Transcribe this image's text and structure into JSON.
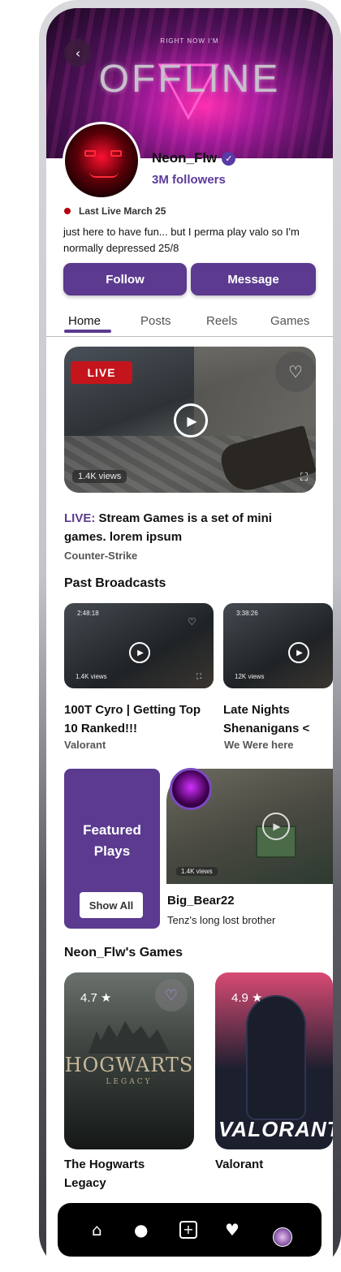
{
  "header": {
    "right_now": "RIGHT NOW I'M",
    "status": "OFFLINE",
    "back_icon": "chevron-left-icon"
  },
  "profile": {
    "name": "Neon_Flw",
    "followers": "3M followers",
    "last_live": "Last Live March 25",
    "bio": "just here to have fun... but I perma play valo so I'm normally depressed 25/8"
  },
  "actions": {
    "follow": "Follow",
    "message": "Message"
  },
  "tabs": [
    "Home",
    "Posts",
    "Reels",
    "Games"
  ],
  "live": {
    "badge": "LIVE",
    "views": "1.4K views",
    "title_prefix": "LIVE:",
    "title": " Stream Games is a set of mini games. lorem ipsum",
    "game": "Counter-Strike"
  },
  "past_broadcasts": {
    "heading": "Past Broadcasts",
    "items": [
      {
        "duration": "2:48:18",
        "views": "1.4K views",
        "title": "100T Cyro | Getting Top 10 Ranked!!!",
        "game": "Valorant"
      },
      {
        "duration": "3:38:26",
        "views": "12K views",
        "title": "Late Nights Shenanigans <",
        "game": "We Were here"
      }
    ]
  },
  "featured": {
    "label": "Featured Plays",
    "show_all": "Show All",
    "views": "1.4K views",
    "user": "Big_Bear22",
    "caption": "Tenz's long lost brother"
  },
  "games": {
    "heading": "Neon_Flw's Games",
    "items": [
      {
        "rating": "4.7 ★",
        "logo": "HOGWARTS",
        "logo_sub": "LEGACY",
        "title": "The Hogwarts Legacy"
      },
      {
        "rating": "4.9 ★",
        "logo": "VALORANT",
        "title": "Valorant"
      }
    ]
  },
  "colors": {
    "accent": "#5b3a8f",
    "live_red": "#c4151c"
  }
}
